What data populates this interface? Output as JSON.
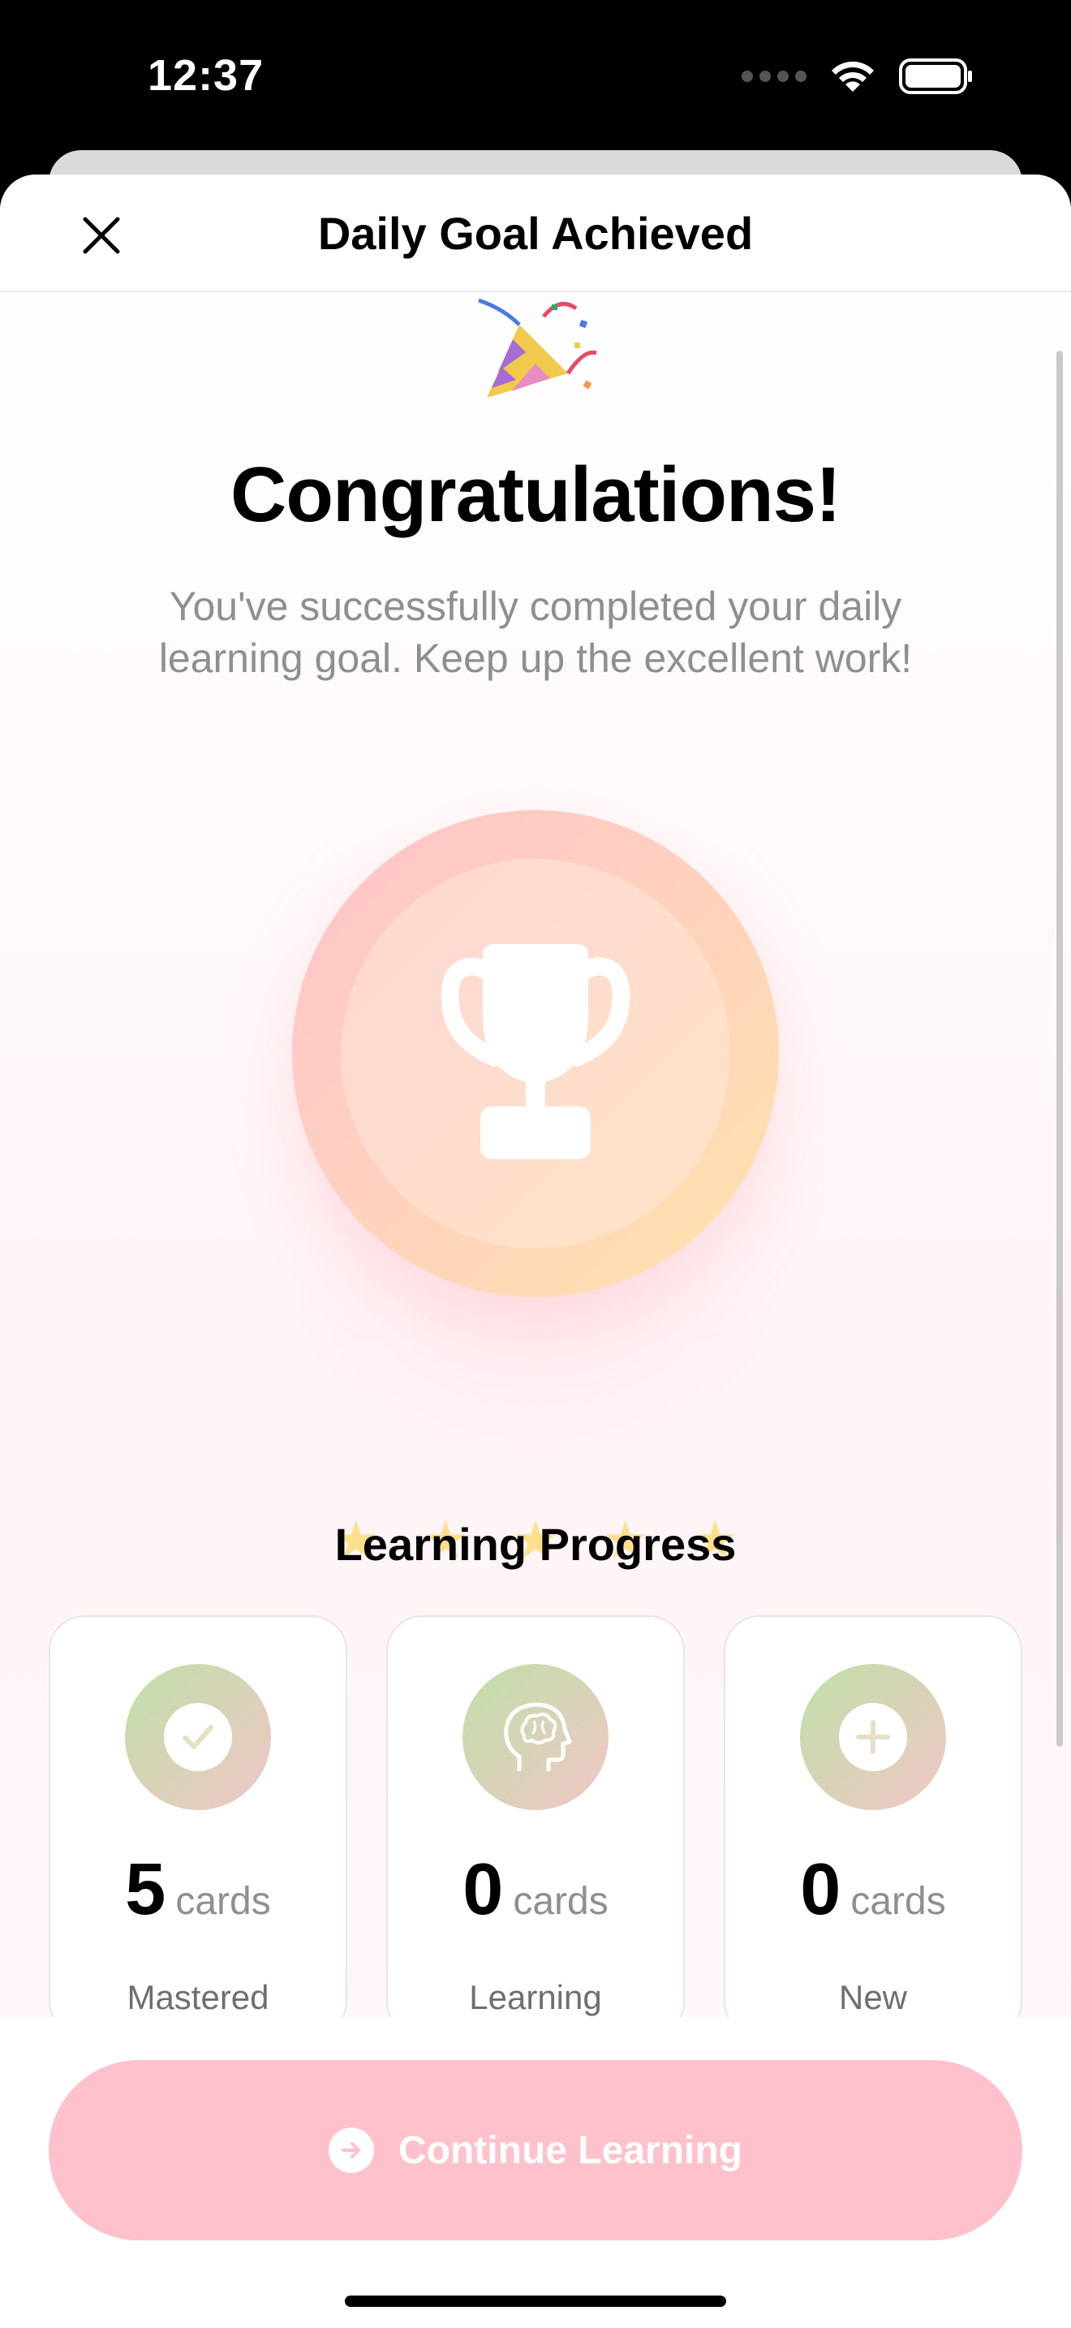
{
  "status_bar": {
    "time": "12:37"
  },
  "nav": {
    "title": "Daily Goal Achieved",
    "close_icon": "close-icon"
  },
  "hero": {
    "emoji": "🎉",
    "title": "Congratulations!",
    "subtitle": "You've successfully completed your daily learning goal. Keep up the excellent work!",
    "trophy_icon": "trophy-icon",
    "stars_count": 5,
    "star_color": "#FFE08A"
  },
  "progress": {
    "title": "Learning Progress",
    "cards": [
      {
        "icon": "checkmark-icon",
        "value": "5",
        "unit": "cards",
        "label": "Mastered"
      },
      {
        "icon": "brain-icon",
        "value": "0",
        "unit": "cards",
        "label": "Learning"
      },
      {
        "icon": "plus-icon",
        "value": "0",
        "unit": "cards",
        "label": "New"
      }
    ]
  },
  "cta": {
    "label": "Continue Learning",
    "icon": "arrow-right-circle-icon",
    "color": "#FFC1CC"
  },
  "colors": {
    "accent_gradient_start": "#FFC4C9",
    "accent_gradient_end": "#FFE3AA",
    "secondary_text": "#8E8E93"
  }
}
